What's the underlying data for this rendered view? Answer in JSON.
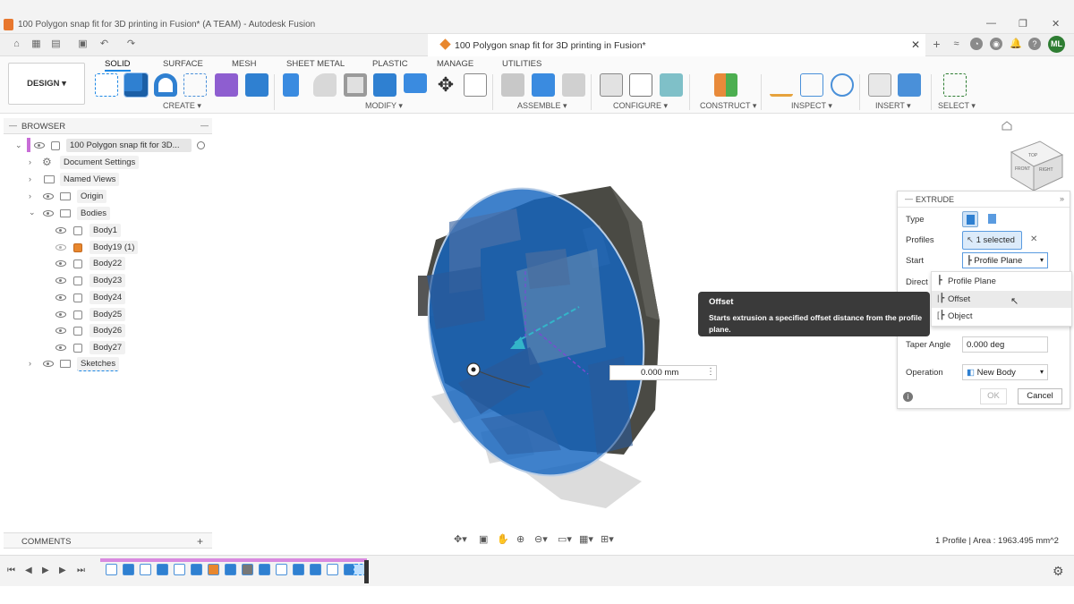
{
  "window": {
    "title": "100 Polygon snap fit for 3D printing in Fusion* (A TEAM) - Autodesk Fusion",
    "minimize": "—",
    "maximize": "❐",
    "close": "✕"
  },
  "document_tab": {
    "label": "100 Polygon snap fit for 3D printing in Fusion*",
    "close": "✕"
  },
  "user": {
    "initials": "ML"
  },
  "workspace": {
    "label": "DESIGN ▾"
  },
  "ribbon": {
    "tabs": [
      "SOLID",
      "SURFACE",
      "MESH",
      "SHEET METAL",
      "PLASTIC",
      "MANAGE",
      "UTILITIES"
    ],
    "groups": [
      "CREATE ▾",
      "MODIFY ▾",
      "ASSEMBLE ▾",
      "CONFIGURE ▾",
      "CONSTRUCT ▾",
      "INSPECT ▾",
      "INSERT ▾",
      "SELECT ▾"
    ]
  },
  "browser": {
    "title": "BROWSER",
    "root": "100 Polygon snap fit for 3D...",
    "items": [
      "Document Settings",
      "Named Views",
      "Origin",
      "Bodies"
    ],
    "bodies": [
      "Body1",
      "Body19 (1)",
      "Body22",
      "Body23",
      "Body24",
      "Body25",
      "Body26",
      "Body27"
    ],
    "sketches": "Sketches"
  },
  "viewcube": {
    "top": "TOP",
    "front": "FRONT",
    "right": "RIGHT"
  },
  "distance_input": {
    "value": "0.000 mm"
  },
  "extrude": {
    "title": "EXTRUDE",
    "type_label": "Type",
    "profiles_label": "Profiles",
    "profiles_value": "1 selected",
    "start_label": "Start",
    "start_value": "Profile Plane",
    "direction_label": "Direct",
    "taper_label": "Taper Angle",
    "taper_value": "0.000 deg",
    "operation_label": "Operation",
    "operation_value": "New Body",
    "ok": "OK",
    "cancel": "Cancel"
  },
  "start_dropdown": {
    "options": [
      "Profile Plane",
      "Offset",
      "Object"
    ],
    "highlighted": "Offset"
  },
  "tooltip": {
    "title": "Offset",
    "text": "Starts extrusion a specified offset distance from the profile plane."
  },
  "comments": {
    "title": "COMMENTS",
    "add": "+"
  },
  "status": {
    "text": "1 Profile | Area : 1963.495 mm^2"
  },
  "colors": {
    "accent": "#1e88e5",
    "selection_blue": "#1565c0",
    "body_dark": "#4a4a44"
  }
}
